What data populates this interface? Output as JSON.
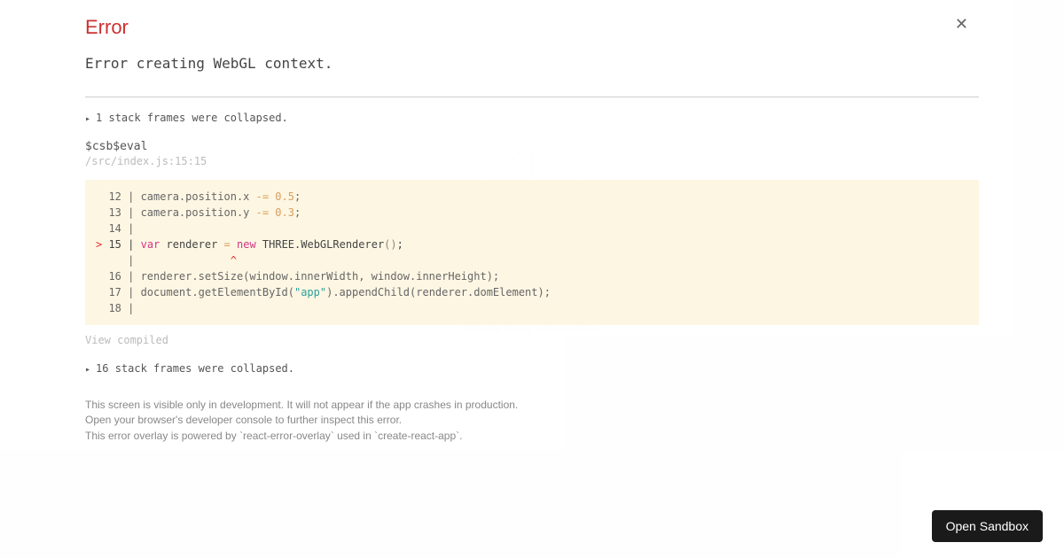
{
  "background": {
    "loading_text": "Transpiling Modules..."
  },
  "error": {
    "title": "Error",
    "message": "Error creating WebGL context."
  },
  "collapsed": {
    "top": "1 stack frames were collapsed.",
    "bottom": "16 stack frames were collapsed."
  },
  "frame": {
    "function_name": "$csb$eval",
    "location": "/src/index.js:15:15"
  },
  "code": {
    "l12": "  12 | camera.position.x ",
    "l12_op": "-=",
    "l12_num": " 0.5",
    "l12_end": ";",
    "l13": "  13 | camera.position.y ",
    "l13_op": "-=",
    "l13_num": " 0.3",
    "l13_end": ";",
    "l14": "  14 | ",
    "l15_gt": ">",
    "l15_pre": " 15 | ",
    "l15_var": "var",
    "l15_mid": " renderer ",
    "l15_eq": "=",
    "l15_new": " new",
    "l15_cls": " THREE.WebGLRenderer",
    "l15_parens": "()",
    "l15_semi": ";",
    "lcaret": "     |               ",
    "lcaret_sym": "^",
    "l16": "  16 | renderer.setSize(window.innerWidth, window.innerHeight);",
    "l17_pre": "  17 | document.getElementById(",
    "l17_str": "\"app\"",
    "l17_post": ").appendChild(renderer.domElement);",
    "l18": "  18 | "
  },
  "view_compiled": "View compiled",
  "footer": {
    "line1": "This screen is visible only in development. It will not appear if the app crashes in production.",
    "line2": "Open your browser's developer console to further inspect this error.",
    "line3": "This error overlay is powered by `react-error-overlay` used in `create-react-app`."
  },
  "sandbox_button": "Open Sandbox"
}
